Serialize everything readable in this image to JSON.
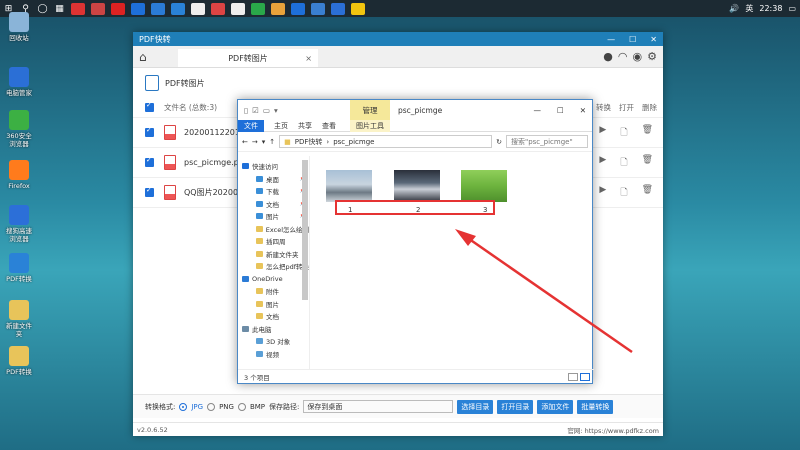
{
  "taskbar": {
    "time": "22:38",
    "ime": "英"
  },
  "desktop_icons": [
    {
      "label": "回收站",
      "color": "#8ab4d8"
    },
    {
      "label": "电脑管家",
      "color": "#2b6fd6"
    },
    {
      "label": "360安全浏览器",
      "color": "#3cb043"
    },
    {
      "label": "Firefox",
      "color": "#ff7b1c"
    },
    {
      "label": "搜狗高速浏览器",
      "color": "#2c6fd8"
    },
    {
      "label": "PDF转换",
      "color": "#2a82d7"
    },
    {
      "label": "新建文件夹",
      "color": "#e8c45a"
    },
    {
      "label": "PDF转换",
      "color": "#e8c45a"
    }
  ],
  "app": {
    "title": "PDF快转",
    "tab_label": "PDF转图片",
    "section_title": "PDF转图片",
    "list_header": {
      "filename": "文件名 (总数:3)",
      "convert": "转换",
      "open": "打开",
      "delete": "删除"
    },
    "rows": [
      {
        "name": "20200112201345"
      },
      {
        "name": "psc_picmge.pdf"
      },
      {
        "name": "QQ图片20200430"
      }
    ],
    "bottom": {
      "format_label": "转换格式:",
      "jpg": "JPG",
      "png": "PNG",
      "bmp": "BMP",
      "save_label": "保存路径:",
      "save_value": "保存到桌面",
      "btn_select": "选择目录",
      "btn_open": "打开目录",
      "btn_add": "添加文件",
      "btn_batch": "批量转换"
    },
    "version": "v2.0.6.52",
    "site": "官网: https://www.pdfkz.com"
  },
  "explorer": {
    "manage": "管理",
    "title": "psc_picmge",
    "picture_tools": "图片工具",
    "ribbon": [
      "主页",
      "共享",
      "查看"
    ],
    "file_tab": "文件",
    "path": [
      "PDF快转",
      "psc_picmge"
    ],
    "search_placeholder": "搜索\"psc_picmge\"",
    "nav": {
      "quick_access": "快速访问",
      "pinned": [
        "桌面",
        "下载",
        "文档",
        "图片"
      ],
      "folders": [
        "Excel怎么绘制",
        "插四周",
        "新建文件夹",
        "怎么把pdf转换"
      ],
      "onedrive": "OneDrive",
      "onedrive_items": [
        "附件",
        "图片",
        "文档"
      ],
      "this_pc": "此电脑",
      "pc_items": [
        "3D 对象",
        "视频"
      ]
    },
    "files": [
      {
        "label": "1"
      },
      {
        "label": "2"
      },
      {
        "label": "3"
      }
    ],
    "status": "3 个项目"
  },
  "colors": {
    "accent": "#1f7fb8",
    "highlight": "#e53333",
    "manage_tab": "#f5e89a"
  }
}
